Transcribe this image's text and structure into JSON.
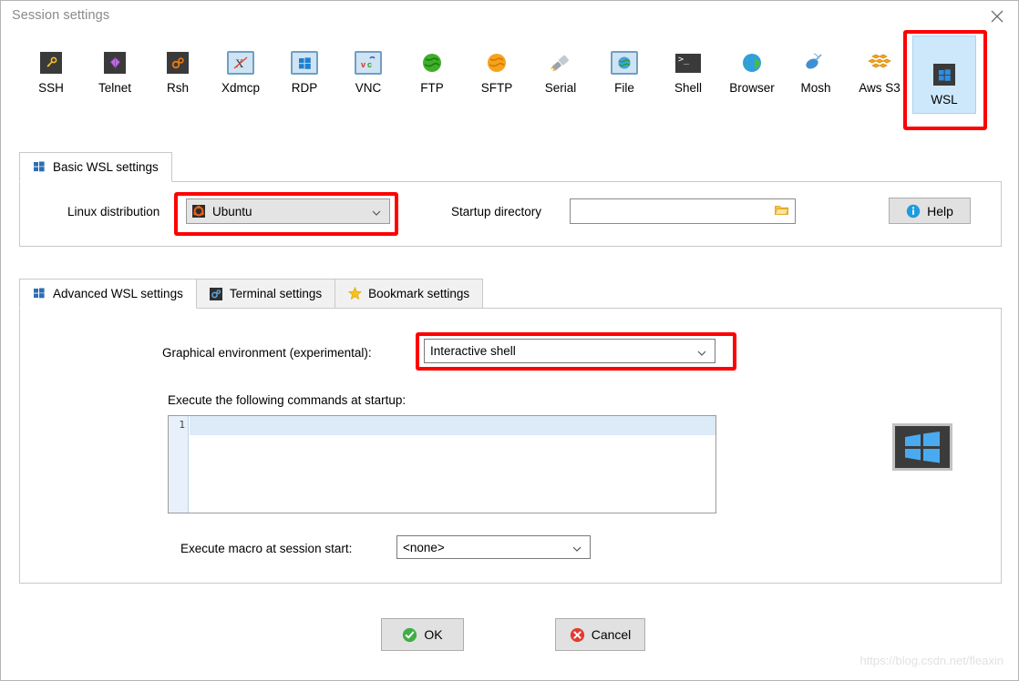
{
  "window": {
    "title": "Session settings",
    "close_icon": "close-icon"
  },
  "toolbar": {
    "items": [
      {
        "label": "SSH",
        "icon": "ssh-key-icon"
      },
      {
        "label": "Telnet",
        "icon": "telnet-gem-icon"
      },
      {
        "label": "Rsh",
        "icon": "rsh-gears-icon"
      },
      {
        "label": "Xdmcp",
        "icon": "xdmcp-monitor-icon"
      },
      {
        "label": "RDP",
        "icon": "rdp-monitor-icon"
      },
      {
        "label": "VNC",
        "icon": "vnc-monitor-icon"
      },
      {
        "label": "FTP",
        "icon": "ftp-green-globe-icon"
      },
      {
        "label": "SFTP",
        "icon": "sftp-orange-globe-icon"
      },
      {
        "label": "Serial",
        "icon": "serial-plug-icon"
      },
      {
        "label": "File",
        "icon": "file-monitor-icon"
      },
      {
        "label": "Shell",
        "icon": "shell-terminal-icon"
      },
      {
        "label": "Browser",
        "icon": "browser-globe-icon"
      },
      {
        "label": "Mosh",
        "icon": "mosh-satellite-icon"
      },
      {
        "label": "Aws S3",
        "icon": "aws-s3-boxes-icon"
      },
      {
        "label": "WSL",
        "icon": "wsl-windows-icon"
      }
    ],
    "selected": "WSL"
  },
  "basic_panel": {
    "tab_label": "Basic WSL settings",
    "tab_icon": "windows-squares-icon",
    "linux_distribution": {
      "label": "Linux distribution",
      "value": "Ubuntu",
      "icon": "ubuntu-icon",
      "chevron": "chevron-down-icon"
    },
    "startup_directory": {
      "label": "Startup directory",
      "value": "",
      "placeholder": "",
      "browse_icon": "folder-open-icon"
    },
    "help_button": {
      "label": "Help",
      "icon": "info-icon"
    }
  },
  "advanced_panel": {
    "tabs": [
      {
        "label": "Advanced WSL settings",
        "icon": "windows-squares-icon",
        "active": true
      },
      {
        "label": "Terminal settings",
        "icon": "terminal-settings-icon",
        "active": false
      },
      {
        "label": "Bookmark settings",
        "icon": "star-icon",
        "active": false
      }
    ],
    "graphical_environment": {
      "label": "Graphical environment (experimental):",
      "value": "Interactive shell",
      "chevron": "chevron-down-icon"
    },
    "startup_commands": {
      "label": "Execute the following commands at startup:",
      "line_number": "1",
      "value": ""
    },
    "execute_macro": {
      "label": "Execute macro at session start:",
      "value": "<none>",
      "chevron": "chevron-down-icon"
    },
    "side_logo_icon": "windows-logo-icon"
  },
  "footer": {
    "ok_button": {
      "label": "OK",
      "icon": "check-circle-icon"
    },
    "cancel_button": {
      "label": "Cancel",
      "icon": "cancel-circle-icon"
    }
  },
  "watermark": "https://blog.csdn.net/fleaxin",
  "colors": {
    "highlight_red": "#fe0000",
    "selection_blue": "#cde8fb",
    "accent_blue": "#1f9bde"
  }
}
